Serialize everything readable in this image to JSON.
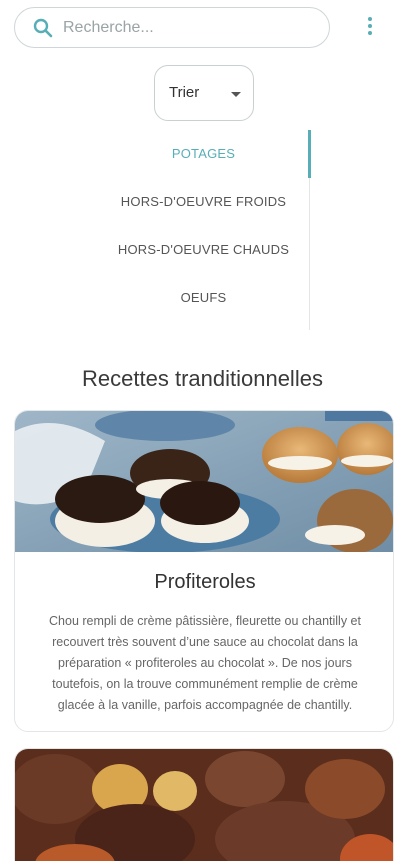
{
  "search": {
    "placeholder": "Recherche..."
  },
  "sort": {
    "label": "Trier"
  },
  "categories": [
    {
      "label": "POTAGES",
      "active": true
    },
    {
      "label": "HORS-D'OEUVRE FROIDS",
      "active": false
    },
    {
      "label": "HORS-D'OEUVRE CHAUDS",
      "active": false
    },
    {
      "label": "OEUFS",
      "active": false
    }
  ],
  "section": {
    "title": "Recettes tranditionnelles"
  },
  "recipes": [
    {
      "title": "Profiteroles",
      "description": "Chou rempli de crème pâtissière, fleurette ou chantilly et recouvert très souvent d’une sauce au chocolat dans la préparation « profiteroles au chocolat ». De nos jours toutefois, on la trouve communément remplie de crème glacée à la vanille, parfois accompagnée de chantilly."
    }
  ],
  "colors": {
    "accent": "#58aeb6",
    "text": "#3a3a3a",
    "muted": "#666666"
  },
  "icons": {
    "search": "search-icon",
    "menu": "more-vert-icon",
    "sort_caret": "caret-down-icon"
  }
}
